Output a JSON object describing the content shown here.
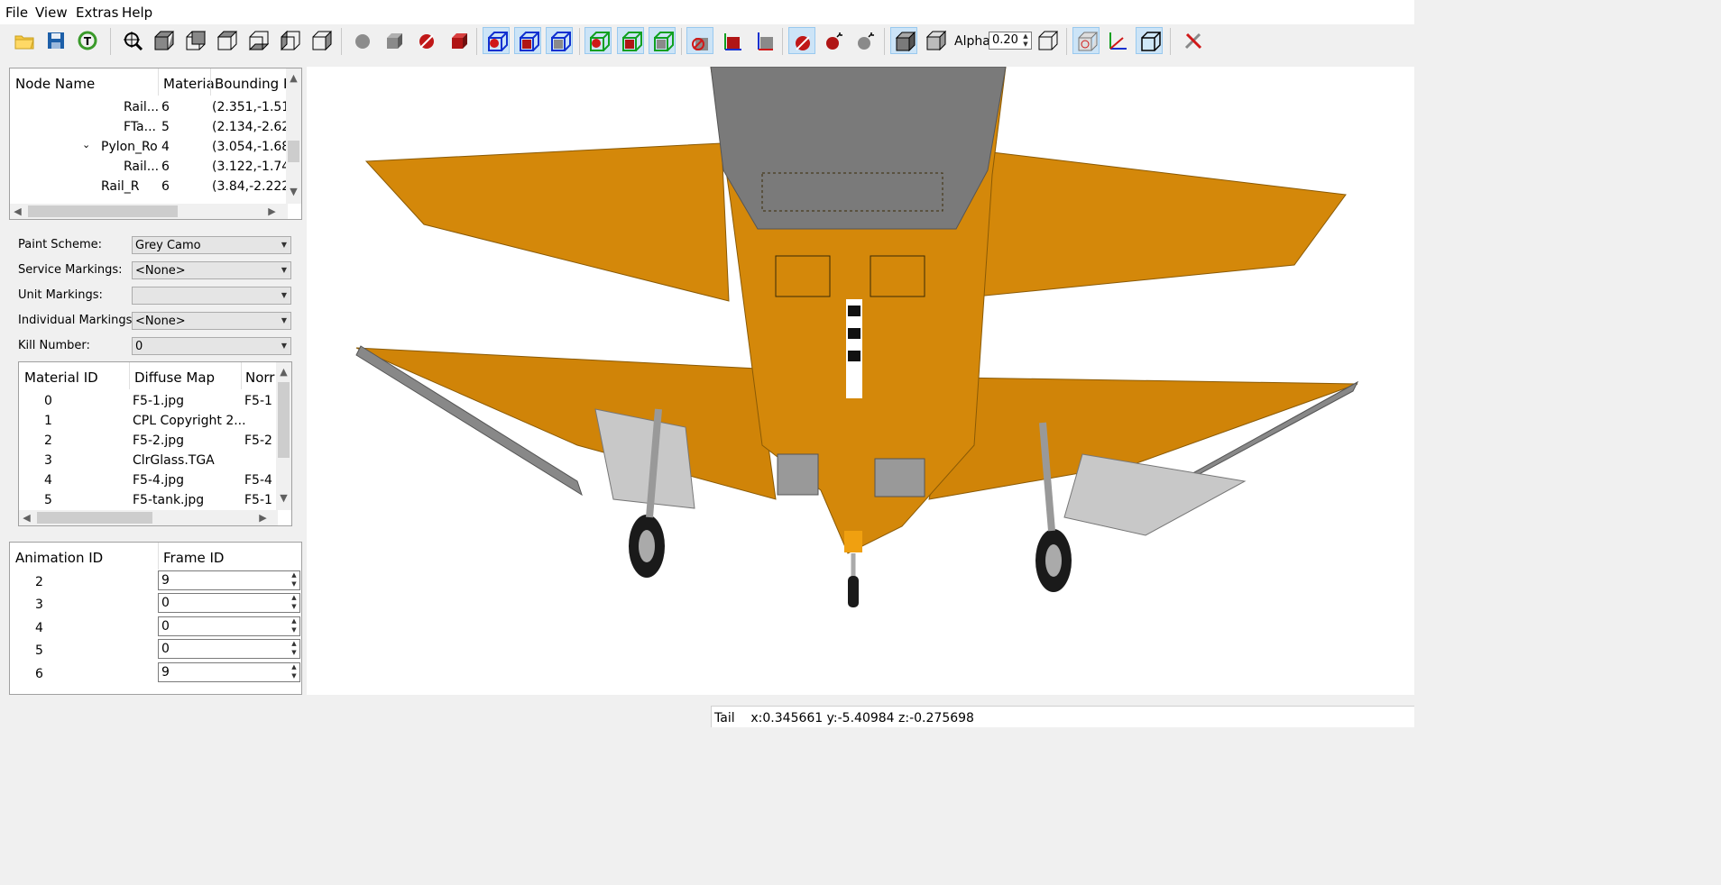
{
  "menu": [
    "File",
    "View",
    "Extras",
    "Help"
  ],
  "toolbar": {
    "buttons": [
      {
        "icon": "open-folder-icon"
      },
      {
        "icon": "save-icon"
      },
      {
        "icon": "reset-icon"
      },
      {
        "icon": "zoom-fit-icon"
      },
      {
        "icon": "view-front-cube-icon"
      },
      {
        "icon": "view-back-cube-icon"
      },
      {
        "icon": "view-top-cube-icon"
      },
      {
        "icon": "view-bottom-cube-icon"
      },
      {
        "icon": "view-left-cube-icon"
      },
      {
        "icon": "view-right-cube-icon"
      },
      {
        "icon": "grey-shape-icon"
      },
      {
        "icon": "grey-cube-icon"
      },
      {
        "icon": "red-shape-hidden-icon"
      },
      {
        "icon": "red-cube-icon"
      },
      {
        "icon": "blue-wire-hidden-icon",
        "active": true
      },
      {
        "icon": "blue-solid-cube-icon",
        "active": true
      },
      {
        "icon": "blue-grey-cube-icon",
        "active": true
      },
      {
        "icon": "green-wire-hidden-icon",
        "active": true
      },
      {
        "icon": "green-red-cube-icon",
        "active": true
      },
      {
        "icon": "green-grey-cube-icon",
        "active": true
      },
      {
        "icon": "axes-hidden-icon",
        "active": true
      },
      {
        "icon": "axes-red-cube-icon"
      },
      {
        "icon": "axes-blue-cube-icon"
      },
      {
        "icon": "bomb-hidden-icon",
        "active": true
      },
      {
        "icon": "bomb-icon"
      },
      {
        "icon": "bomb-grey-icon"
      },
      {
        "icon": "solid-cube-icon",
        "active": true
      },
      {
        "icon": "alpha-cube-icon"
      },
      {
        "icon": "wire-cube-icon"
      },
      {
        "icon": "ghost-cube-icon",
        "active": true
      },
      {
        "icon": "axis-icon"
      },
      {
        "icon": "blue-box-icon",
        "active": true
      },
      {
        "icon": "tools-icon"
      }
    ],
    "alpha_label": "Alpha:",
    "alpha_value": "0.20"
  },
  "node_tree": {
    "headers": [
      "Node Name",
      "Materia",
      "Bounding B"
    ],
    "rows": [
      {
        "name": "Rail...",
        "material": "6",
        "bounds": "(2.351,-1.51"
      },
      {
        "name": "FTa...",
        "material": "5",
        "bounds": "(2.134,-2.62"
      },
      {
        "name": "Pylon_Ro",
        "material": "4",
        "bounds": "(3.054,-1.68",
        "expanded": true
      },
      {
        "name": "Rail...",
        "material": "6",
        "bounds": "(3.122,-1.74"
      },
      {
        "name": "Rail_R",
        "material": "6",
        "bounds": "(3.84,-2.222"
      }
    ]
  },
  "markings": {
    "paint_scheme": {
      "label": "Paint Scheme:",
      "value": "Grey Camo"
    },
    "service_markings": {
      "label": "Service Markings:",
      "value": "<None>"
    },
    "unit_markings": {
      "label": "Unit Markings:",
      "value": ""
    },
    "individual_markings": {
      "label": "Individual Markings:",
      "value": "<None>"
    },
    "kill_number": {
      "label": "Kill Number:",
      "value": "0"
    }
  },
  "materials": {
    "headers": [
      "Material ID",
      "Diffuse Map",
      "Norr"
    ],
    "rows": [
      {
        "id": "0",
        "diffuse": "F5-1.jpg",
        "normal": "F5-1"
      },
      {
        "id": "1",
        "diffuse": "CPL Copyright 2...",
        "normal": ""
      },
      {
        "id": "2",
        "diffuse": "F5-2.jpg",
        "normal": "F5-2"
      },
      {
        "id": "3",
        "diffuse": "ClrGlass.TGA",
        "normal": ""
      },
      {
        "id": "4",
        "diffuse": "F5-4.jpg",
        "normal": "F5-4"
      },
      {
        "id": "5",
        "diffuse": "F5-tank.jpg",
        "normal": "F5-1"
      }
    ]
  },
  "animations": {
    "headers": [
      "Animation ID",
      "Frame ID"
    ],
    "rows": [
      {
        "id": "2",
        "frame": "9"
      },
      {
        "id": "3",
        "frame": "0"
      },
      {
        "id": "4",
        "frame": "0"
      },
      {
        "id": "5",
        "frame": "0"
      },
      {
        "id": "6",
        "frame": "9"
      }
    ]
  },
  "status": {
    "text": "Tail    x:0.345661 y:-5.40984 z:-0.275698"
  },
  "colors": {
    "airframe": "#d4880a",
    "fuselage_grey": "#7a7a7a",
    "selection_blue": "#cce4f7"
  }
}
